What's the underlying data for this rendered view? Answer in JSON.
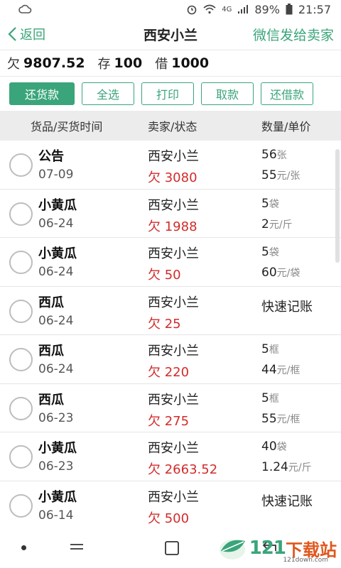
{
  "status_bar": {
    "battery": "89%",
    "time": "21:57",
    "network": "4G"
  },
  "header": {
    "back_label": "返回",
    "title": "西安小兰",
    "wechat_label": "微信发给卖家"
  },
  "summary": {
    "owe_label": "欠",
    "owe_value": "9807.52",
    "deposit_label": "存",
    "deposit_value": "100",
    "borrow_label": "借",
    "borrow_value": "1000"
  },
  "buttons": {
    "repay": "还货款",
    "select_all": "全选",
    "print": "打印",
    "withdraw": "取款",
    "repay_loan": "还借款"
  },
  "table": {
    "col1": "货品/买货时间",
    "col2": "卖家/状态",
    "col3": "数量/单价",
    "rows": [
      {
        "name": "公告",
        "date": "07-09",
        "seller": "西安小兰",
        "debt": "欠 3080",
        "qty": "56",
        "qty_unit": "张",
        "price": "55",
        "price_unit": "元/张",
        "quick": ""
      },
      {
        "name": "小黄瓜",
        "date": "06-24",
        "seller": "西安小兰",
        "debt": "欠 1988",
        "qty": "5",
        "qty_unit": "袋",
        "price": "2",
        "price_unit": "元/斤",
        "quick": ""
      },
      {
        "name": "小黄瓜",
        "date": "06-24",
        "seller": "西安小兰",
        "debt": "欠 50",
        "qty": "5",
        "qty_unit": "袋",
        "price": "60",
        "price_unit": "元/袋",
        "quick": ""
      },
      {
        "name": "西瓜",
        "date": "06-24",
        "seller": "西安小兰",
        "debt": "欠 25",
        "qty": "",
        "qty_unit": "",
        "price": "",
        "price_unit": "",
        "quick": "快速记账"
      },
      {
        "name": "西瓜",
        "date": "06-24",
        "seller": "西安小兰",
        "debt": "欠 220",
        "qty": "5",
        "qty_unit": "框",
        "price": "44",
        "price_unit": "元/框",
        "quick": ""
      },
      {
        "name": "西瓜",
        "date": "06-23",
        "seller": "西安小兰",
        "debt": "欠 275",
        "qty": "5",
        "qty_unit": "框",
        "price": "55",
        "price_unit": "元/框",
        "quick": ""
      },
      {
        "name": "小黄瓜",
        "date": "06-23",
        "seller": "西安小兰",
        "debt": "欠 2663.52",
        "qty": "40",
        "qty_unit": "袋",
        "price": "1.24",
        "price_unit": "元/斤",
        "quick": ""
      },
      {
        "name": "小黄瓜",
        "date": "06-14",
        "seller": "西安小兰",
        "debt": "欠 500",
        "qty": "",
        "qty_unit": "",
        "price": "",
        "price_unit": "",
        "quick": "快速记账"
      }
    ]
  },
  "watermark": {
    "brand_num": "121",
    "brand_text": "下载站",
    "brand_url": "121down.com"
  },
  "colors": {
    "accent": "#3aa57a",
    "debt": "#d22b2b"
  }
}
